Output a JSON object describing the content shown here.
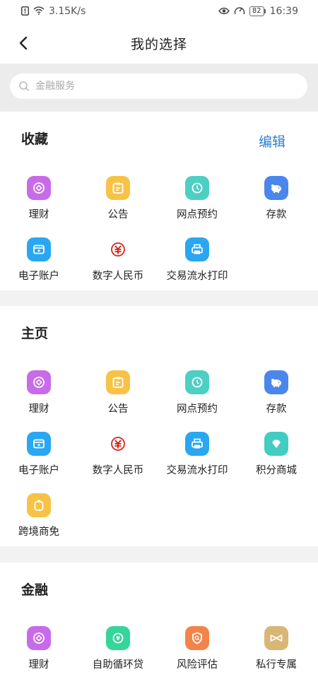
{
  "status_bar": {
    "speed": "3.15K/s",
    "battery": "82",
    "time": "16:39",
    "icons": [
      "alert-icon",
      "wifi-icon",
      "eye-icon",
      "speedometer-icon",
      "battery-icon"
    ]
  },
  "header": {
    "title": "我的选择",
    "back_icon": "chevron-left-icon"
  },
  "search": {
    "placeholder": "金融服务",
    "value": ""
  },
  "favorites": {
    "title": "收藏",
    "edit_label": "编辑",
    "items": [
      {
        "label": "理财",
        "icon": "wealth-icon",
        "color": "#c86be8"
      },
      {
        "label": "公告",
        "icon": "notice-icon",
        "color": "#f7c346"
      },
      {
        "label": "网点预约",
        "icon": "location-icon",
        "color": "#4dcfc4"
      },
      {
        "label": "存款",
        "icon": "piggy-bank-icon",
        "color": "#4a86ec"
      },
      {
        "label": "电子账户",
        "icon": "ecard-icon",
        "color": "#2aa7f0"
      },
      {
        "label": "数字人民币",
        "icon": "digital-rmb-icon",
        "color": "#d9251c"
      },
      {
        "label": "交易流水打印",
        "icon": "printer-icon",
        "color": "#2aa7f0"
      }
    ]
  },
  "home": {
    "title": "主页",
    "items": [
      {
        "label": "理财",
        "icon": "wealth-icon",
        "color": "#c86be8"
      },
      {
        "label": "公告",
        "icon": "notice-icon",
        "color": "#f7c346"
      },
      {
        "label": "网点预约",
        "icon": "location-icon",
        "color": "#4dcfc4"
      },
      {
        "label": "存款",
        "icon": "piggy-bank-icon",
        "color": "#4a86ec"
      },
      {
        "label": "电子账户",
        "icon": "ecard-icon",
        "color": "#2aa7f0"
      },
      {
        "label": "数字人民币",
        "icon": "digital-rmb-icon",
        "color": "#d9251c"
      },
      {
        "label": "交易流水打印",
        "icon": "printer-icon",
        "color": "#2aa7f0"
      },
      {
        "label": "积分商城",
        "icon": "diamond-icon",
        "color": "#42cdc2"
      },
      {
        "label": "跨境商免",
        "icon": "bag-icon",
        "color": "#f7c346"
      }
    ]
  },
  "finance": {
    "title": "金融",
    "items": [
      {
        "label": "理财",
        "icon": "wealth-icon",
        "color": "#c86be8"
      },
      {
        "label": "自助循环贷",
        "icon": "loan-icon",
        "color": "#34d69a"
      },
      {
        "label": "风险评估",
        "icon": "shield-icon",
        "color": "#f2844a"
      },
      {
        "label": "私行专属",
        "icon": "bow-icon",
        "color": "#d8b675"
      }
    ]
  }
}
